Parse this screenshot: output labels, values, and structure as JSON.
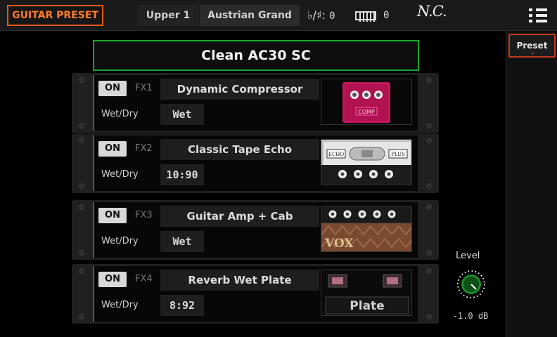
{
  "header": {
    "page_title": "GUITAR PRESET",
    "track": "Upper 1",
    "sound": "Austrian Grand",
    "transpose_symbol": "♭/♯:",
    "transpose_value": "0",
    "octave_value": "0",
    "chord": "N.C.",
    "icons": [
      "keyboard-icon",
      "menu-icon"
    ]
  },
  "side": {
    "preset_tab": "Preset"
  },
  "preset_name": "Clean AC30 SC",
  "fx": [
    {
      "on_label": "ON",
      "id": "FX1",
      "name": "Dynamic Compressor",
      "wetdry_label": "Wet/Dry",
      "wetdry_value": "Wet",
      "thumb_text": "COMP"
    },
    {
      "on_label": "ON",
      "id": "FX2",
      "name": "Classic Tape Echo",
      "wetdry_label": "Wet/Dry",
      "wetdry_value": "10:90",
      "thumb_text": "ECHO",
      "thumb_text2": "PLUS"
    },
    {
      "on_label": "ON",
      "id": "FX3",
      "name": "Guitar Amp + Cab",
      "wetdry_label": "Wet/Dry",
      "wetdry_value": "Wet",
      "thumb_text": "VOX"
    },
    {
      "on_label": "ON",
      "id": "FX4",
      "name": "Reverb Wet Plate",
      "wetdry_label": "Wet/Dry",
      "wetdry_value": "8:92",
      "thumb_text": "Plate"
    }
  ],
  "level": {
    "label": "Level",
    "value": "-1.0 dB"
  },
  "colors": {
    "accent_orange": "#e05a1a",
    "green": "#19a52a",
    "preset_red": "#c03a20"
  }
}
